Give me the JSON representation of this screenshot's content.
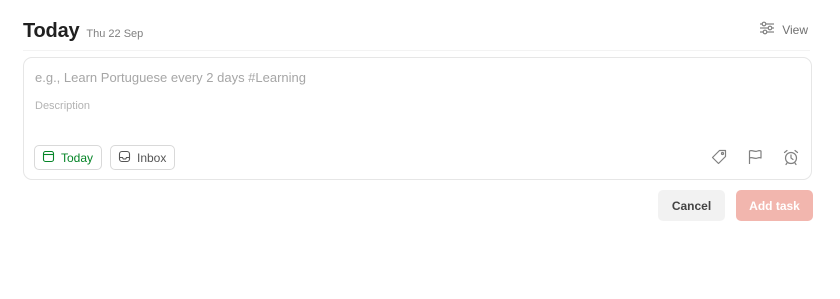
{
  "header": {
    "title": "Today",
    "date": "Thu 22 Sep",
    "view_label": "View"
  },
  "editor": {
    "task_placeholder": "e.g., Learn Portuguese every 2 days #Learning",
    "task_value": "",
    "description_placeholder": "Description",
    "description_value": "",
    "due_chip_label": "Today",
    "project_chip_label": "Inbox"
  },
  "actions": {
    "cancel_label": "Cancel",
    "add_label": "Add task"
  },
  "colors": {
    "due_today": "#058527",
    "add_task_disabled": "#f2b6ae",
    "icon_gray": "#808080"
  },
  "icons": {
    "view": "sliders-icon",
    "due": "calendar-icon",
    "project": "inbox-icon",
    "label": "tag-icon",
    "priority": "flag-icon",
    "reminder": "alarm-clock-icon"
  }
}
